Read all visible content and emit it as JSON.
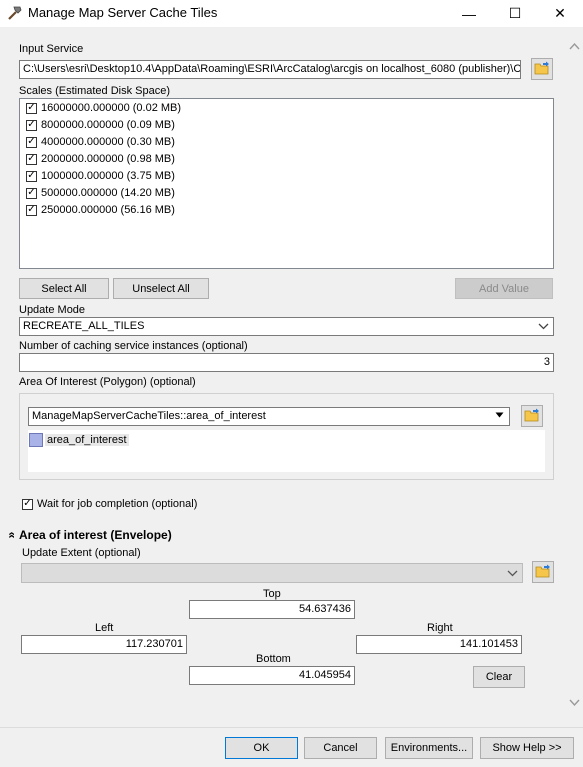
{
  "window": {
    "title": "Manage Map Server Cache Tiles",
    "minimize_glyph": "—",
    "maximize_glyph": "☐",
    "close_glyph": "✕"
  },
  "input_service": {
    "label": "Input Service",
    "value": "C:\\Users\\esri\\Desktop10.4\\AppData\\Roaming\\ESRI\\ArcCatalog\\arcgis on localhost_6080 (publisher)\\C"
  },
  "scales": {
    "label": "Scales (Estimated Disk Space)",
    "items": [
      {
        "label": "16000000.000000 (0.02 MB)",
        "checked": true
      },
      {
        "label": "8000000.000000 (0.09 MB)",
        "checked": true
      },
      {
        "label": "4000000.000000 (0.30 MB)",
        "checked": true
      },
      {
        "label": "2000000.000000 (0.98 MB)",
        "checked": true
      },
      {
        "label": "1000000.000000 (3.75 MB)",
        "checked": true
      },
      {
        "label": "500000.000000 (14.20 MB)",
        "checked": true
      },
      {
        "label": "250000.000000 (56.16 MB)",
        "checked": true
      }
    ],
    "select_all": "Select All",
    "unselect_all": "Unselect All",
    "add_value": "Add Value"
  },
  "update_mode": {
    "label": "Update Mode",
    "value": "RECREATE_ALL_TILES"
  },
  "instances": {
    "label": "Number of caching service instances (optional)",
    "value": "3"
  },
  "aoi": {
    "label": "Area Of Interest (Polygon) (optional)",
    "dropdown_value": "ManageMapServerCacheTiles::area_of_interest",
    "layer_name": "area_of_interest",
    "layer_color": "#a9b3e8"
  },
  "wait": {
    "label": "Wait for job completion (optional)",
    "checked": true
  },
  "envelope": {
    "section_title": "Area of interest (Envelope)",
    "collapse_glyph": "»",
    "update_extent_label": "Update Extent (optional)",
    "top_label": "Top",
    "top_value": "54.637436",
    "left_label": "Left",
    "left_value": "117.230701",
    "right_label": "Right",
    "right_value": "141.101453",
    "bottom_label": "Bottom",
    "bottom_value": "41.045954",
    "clear": "Clear"
  },
  "footer": {
    "ok": "OK",
    "cancel": "Cancel",
    "environments": "Environments...",
    "show_help": "Show Help >>"
  },
  "check_glyph": "✓"
}
